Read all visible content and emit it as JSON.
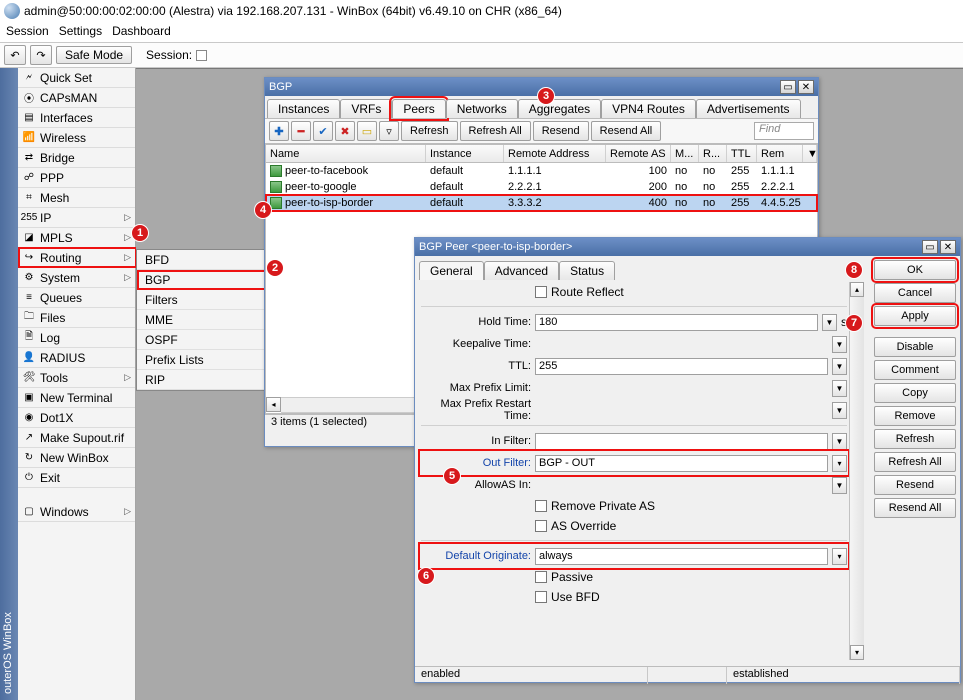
{
  "title": "admin@50:00:00:02:00:00 (Alestra) via 192.168.207.131 - WinBox (64bit) v6.49.10 on CHR (x86_64)",
  "menu": {
    "session": "Session",
    "settings": "Settings",
    "dashboard": "Dashboard"
  },
  "toolbar": {
    "safe": "Safe Mode",
    "session": "Session:"
  },
  "vtab": "outerOS  WinBox",
  "sidebar": [
    {
      "label": "Quick Set",
      "icon": "🗲"
    },
    {
      "label": "CAPsMAN",
      "icon": "⦿"
    },
    {
      "label": "Interfaces",
      "icon": "▤"
    },
    {
      "label": "Wireless",
      "icon": "📶"
    },
    {
      "label": "Bridge",
      "icon": "⇄"
    },
    {
      "label": "PPP",
      "icon": "☍"
    },
    {
      "label": "Mesh",
      "icon": "⌗"
    },
    {
      "label": "IP",
      "icon": "255",
      "exp": true
    },
    {
      "label": "MPLS",
      "icon": "◪",
      "exp": true
    },
    {
      "label": "Routing",
      "icon": "↪",
      "exp": true,
      "hl": true
    },
    {
      "label": "System",
      "icon": "⚙",
      "exp": true
    },
    {
      "label": "Queues",
      "icon": "≡"
    },
    {
      "label": "Files",
      "icon": "🗀"
    },
    {
      "label": "Log",
      "icon": "🗎"
    },
    {
      "label": "RADIUS",
      "icon": "👤"
    },
    {
      "label": "Tools",
      "icon": "🛠",
      "exp": true
    },
    {
      "label": "New Terminal",
      "icon": "▣"
    },
    {
      "label": "Dot1X",
      "icon": "◉"
    },
    {
      "label": "Make Supout.rif",
      "icon": "↗"
    },
    {
      "label": "New WinBox",
      "icon": "↻"
    },
    {
      "label": "Exit",
      "icon": "⏻"
    },
    {
      "label": "Windows",
      "icon": "▢",
      "exp": true,
      "gap": true
    }
  ],
  "submenu": [
    "BFD",
    "BGP",
    "Filters",
    "MME",
    "OSPF",
    "Prefix Lists",
    "RIP"
  ],
  "bgp_win": {
    "title": "BGP",
    "tabs": [
      "Instances",
      "VRFs",
      "Peers",
      "Networks",
      "Aggregates",
      "VPN4 Routes",
      "Advertisements"
    ],
    "active_tab": 2,
    "btns": {
      "refresh": "Refresh",
      "refresh_all": "Refresh All",
      "resend": "Resend",
      "resend_all": "Resend All",
      "find": "Find"
    },
    "cols": [
      "Name",
      "Instance",
      "Remote Address",
      "Remote AS",
      "M...",
      "R...",
      "TTL",
      "Rem"
    ],
    "rows": [
      {
        "name": "peer-to-facebook",
        "inst": "default",
        "addr": "1.1.1.1",
        "as": "100",
        "m": "no",
        "r": "no",
        "ttl": "255",
        "rem": "1.1.1.1"
      },
      {
        "name": "peer-to-google",
        "inst": "default",
        "addr": "2.2.2.1",
        "as": "200",
        "m": "no",
        "r": "no",
        "ttl": "255",
        "rem": "2.2.2.1"
      },
      {
        "name": "peer-to-isp-border",
        "inst": "default",
        "addr": "3.3.3.2",
        "as": "400",
        "m": "no",
        "r": "no",
        "ttl": "255",
        "rem": "4.4.5.25",
        "sel": true,
        "hl": true
      }
    ],
    "status": "3 items (1 selected)"
  },
  "peer_win": {
    "title": "BGP Peer <peer-to-isp-border>",
    "tabs": [
      "General",
      "Advanced",
      "Status"
    ],
    "route_reflect": "Route Reflect",
    "hold_time": {
      "label": "Hold Time:",
      "value": "180",
      "suffix": "s"
    },
    "keepalive": {
      "label": "Keepalive Time:"
    },
    "ttl": {
      "label": "TTL:",
      "value": "255"
    },
    "max_prefix": {
      "label": "Max Prefix Limit:"
    },
    "max_prefix_restart": {
      "label": "Max Prefix Restart Time:"
    },
    "in_filter": {
      "label": "In Filter:"
    },
    "out_filter": {
      "label": "Out Filter:",
      "value": "BGP - OUT"
    },
    "allowas": {
      "label": "AllowAS In:"
    },
    "remove_private": "Remove Private AS",
    "as_override": "AS Override",
    "default_orig": {
      "label": "Default Originate:",
      "value": "always"
    },
    "passive": "Passive",
    "use_bfd": "Use BFD",
    "status_l": "enabled",
    "status_r": "established",
    "actions": [
      "OK",
      "Cancel",
      "Apply",
      "Disable",
      "Comment",
      "Copy",
      "Remove",
      "Refresh",
      "Refresh All",
      "Resend",
      "Resend All"
    ]
  },
  "ann": {
    "1": "1",
    "2": "2",
    "3": "3",
    "4": "4",
    "5": "5",
    "6": "6",
    "7": "7",
    "8": "8"
  }
}
